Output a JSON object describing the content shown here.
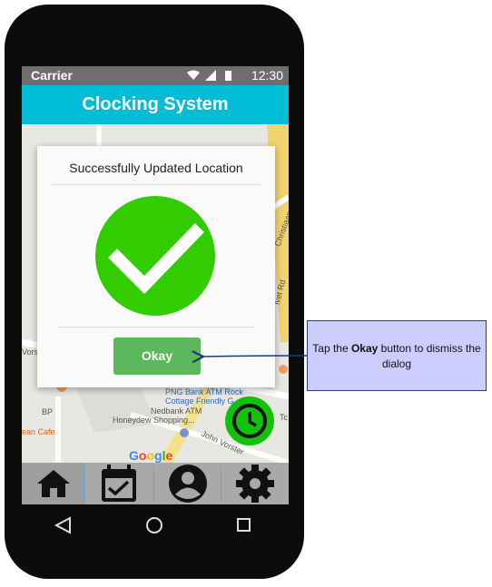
{
  "status": {
    "carrier": "Carrier",
    "time": "12:30"
  },
  "appbar": {
    "title": "Clocking System"
  },
  "map": {
    "labels": [
      "PNG Bank ATM Rock",
      "Cottage Friendly G",
      "Nedbank ATM",
      "Honeydew Shopping...",
      "BP",
      "ean Cafe",
      "John Vorster",
      "Christiaan",
      "Vorst",
      "ivet Rd",
      "Tc"
    ],
    "attribution": "Google"
  },
  "dialog": {
    "title": "Successfully Updated Location",
    "ok_label": "Okay",
    "icon": "check-circle-icon",
    "check_color": "#33cc00"
  },
  "fab": {
    "icon": "clock-icon",
    "color": "#12c10a"
  },
  "bottom_nav": {
    "items": [
      {
        "icon": "home-icon"
      },
      {
        "icon": "calendar-check-icon"
      },
      {
        "icon": "account-icon"
      },
      {
        "icon": "settings-icon"
      }
    ]
  },
  "system_nav": {
    "items": [
      "back-icon",
      "home-circle-icon",
      "recents-icon"
    ]
  },
  "callout": {
    "prefix": "Tap the ",
    "bold": "Okay",
    "suffix": " button to dismiss the dialog"
  },
  "colors": {
    "accent": "#00bcd4",
    "ok_button": "#5cb85c",
    "callout_bg": "#ccccff"
  }
}
